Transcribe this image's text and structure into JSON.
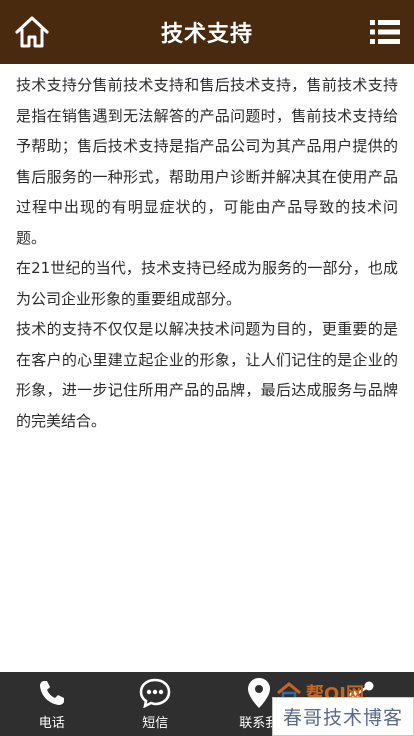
{
  "header": {
    "title": "技术支持",
    "home_icon": "home-icon",
    "menu_icon": "menu-icon",
    "background": "#4a2a0f"
  },
  "content": {
    "paragraphs": [
      "技术支持分售前技术支持和售后技术支持，售前技术支持是指在销售遇到无法解答的产品问题时，售前技术支持给予帮助；售后技术支持是指产品公司为其产品用户提供的售后服务的一种形式，帮助用户诊断并解决其在使用产品过程中出现的有明显症状的，可能由产品导致的技术问题。",
      "在21世纪的当代，技术支持已经成为服务的一部分，也成为公司企业形象的重要组成部分。",
      "技术的支持不仅仅是以解决技术问题为目的，更重要的是在客户的心里建立起企业的形象，让人们记住的是企业的形象，进一步记住所用产品的品牌，最后达成服务与品牌的完美结合。"
    ]
  },
  "bottom_bar": {
    "background": "#2f2f2f",
    "tabs": [
      {
        "label": "电话",
        "icon": "phone-icon"
      },
      {
        "label": "短信",
        "icon": "sms-icon"
      },
      {
        "label": "联系我",
        "icon": "location-icon"
      },
      {
        "label": "",
        "icon": "share-icon"
      }
    ]
  },
  "watermark": {
    "text": "春哥技术博客",
    "logo_text": "帮QI网"
  }
}
